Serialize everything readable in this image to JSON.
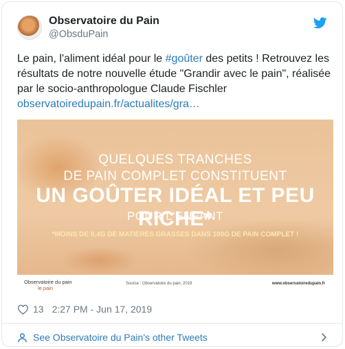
{
  "author": {
    "name": "Observatoire du Pain",
    "handle": "@ObsduPain"
  },
  "tweet": {
    "text_before": "Le pain, l'aliment idéal pour le ",
    "hashtag": "#goûter",
    "text_after": " des petits ! Retrouvez les résultats de notre nouvelle étude \"Grandir avec le pain\", réalisée par le socio-anthropologue Claude Fischler",
    "link": "observatoiredupain.fr/actualites/gra…"
  },
  "media": {
    "line1": "QUELQUES TRANCHES",
    "line2": "DE PAIN COMPLET CONSTITUENT",
    "line3": "UN GOÛTER IDÉAL ET PEU RICHE*",
    "line4": "POUR L'ENFANT",
    "note": "*MOINS DE 0,4G DE MATIÈRES GRASSES DANS 100G DE PAIN COMPLET !",
    "logo_text": "Observatoire du pain",
    "logo_sub": "le pain",
    "source": "Source : Observatoire du pain, 2019",
    "url": "www.observatoiredupain.fr"
  },
  "meta": {
    "likes": "13",
    "timestamp": "2:27 PM - Jun 17, 2019"
  },
  "footer": {
    "label": "See Observatoire du Pain's other Tweets"
  },
  "colors": {
    "link": "#2b7bb9",
    "muted": "#697882",
    "twitter_blue": "#1da1f2"
  },
  "icons": [
    "twitter-bird-icon",
    "heart-icon",
    "person-icon",
    "chevron-right-icon"
  ]
}
